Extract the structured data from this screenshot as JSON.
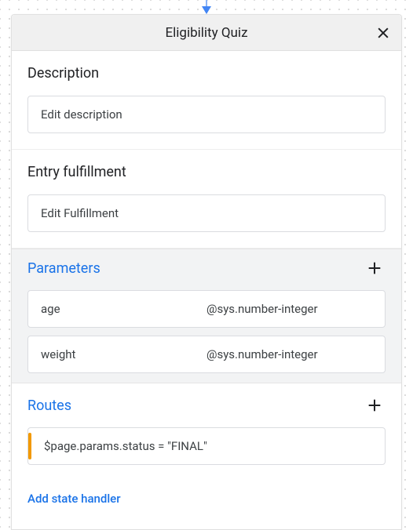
{
  "header": {
    "title": "Eligibility Quiz"
  },
  "sections": {
    "description": {
      "heading": "Description",
      "field_label": "Edit description"
    },
    "entry_fulfillment": {
      "heading": "Entry fulfillment",
      "field_label": "Edit Fulfillment"
    },
    "parameters": {
      "heading": "Parameters",
      "items": [
        {
          "name": "age",
          "type": "@sys.number-integer"
        },
        {
          "name": "weight",
          "type": "@sys.number-integer"
        }
      ]
    },
    "routes": {
      "heading": "Routes",
      "items": [
        {
          "condition": "$page.params.status = \"FINAL\""
        }
      ]
    }
  },
  "add_state_handler_label": "Add state handler"
}
